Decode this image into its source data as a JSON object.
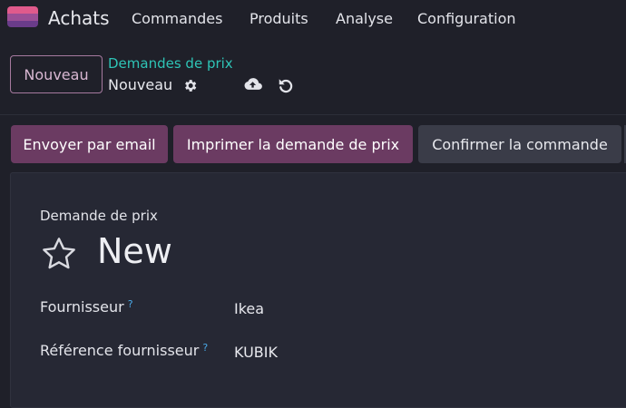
{
  "navbar": {
    "app_name": "Achats",
    "items": [
      "Commandes",
      "Produits",
      "Analyse",
      "Configuration"
    ]
  },
  "control_panel": {
    "new_button": "Nouveau",
    "breadcrumb_parent": "Demandes de prix",
    "breadcrumb_current": "Nouveau"
  },
  "actions": {
    "send_email": "Envoyer par email",
    "print_rfq": "Imprimer la demande de prix",
    "confirm_order": "Confirmer la commande"
  },
  "form": {
    "doc_type": "Demande de prix",
    "record_name": "New",
    "fields": [
      {
        "label": "Fournisseur",
        "help": "?",
        "value": "Ikea"
      },
      {
        "label": "Référence fournisseur",
        "help": "?",
        "value": "KUBIK"
      }
    ]
  },
  "icons": {
    "app": "purchase-app-icon",
    "settings": "gear-icon",
    "save": "cloud-upload-icon",
    "discard": "undo-icon",
    "favorite": "star-icon"
  },
  "colors": {
    "background": "#1f2029",
    "primary": "#6b3b62",
    "breadcrumb_link": "#2ec4b6",
    "help_tooltip": "#4aa9e8"
  }
}
